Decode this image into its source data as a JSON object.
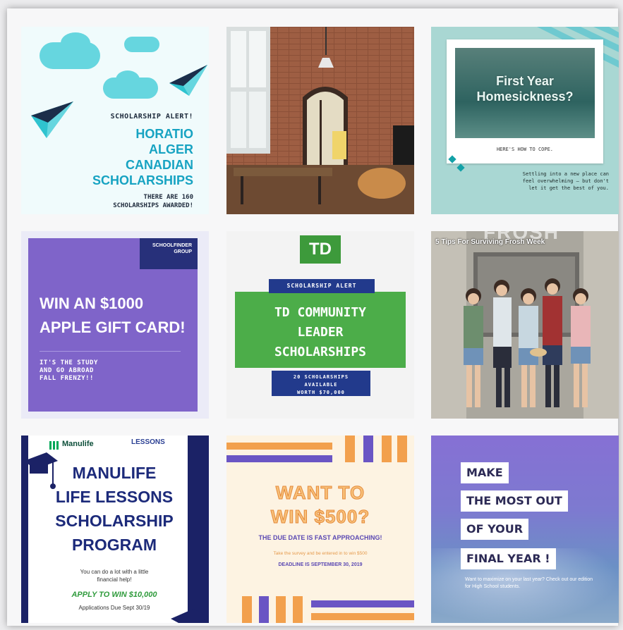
{
  "tile1": {
    "alert": "SCHOLARSHIP ALERT!",
    "title_l1": "HORATIO",
    "title_l2": "ALGER",
    "title_l3": "CANADIAN",
    "title_l4": "SCHOLARSHIPS",
    "foot_l1": "THERE ARE 160",
    "foot_l2": "SCHOLARSHIPS AWARDED!"
  },
  "tile3": {
    "head_l1": "First Year",
    "head_l2": "Homesickness?",
    "cope": "HERE'S HOW TO COPE.",
    "body": "Settling into a new place can feel overwhelming – but don't let it get the best of you."
  },
  "tile4": {
    "logo": "SCHOOLFINDER GROUP",
    "head_l1": "WIN AN $1000",
    "head_l2": "APPLE GIFT CARD!",
    "sub_l1": "IT'S THE STUDY",
    "sub_l2": "AND GO ABROAD",
    "sub_l3": "FALL FRENZY!!"
  },
  "tile5": {
    "logo": "TD",
    "alert": "SCHOLARSHIP ALERT",
    "title_l1": "TD COMMUNITY",
    "title_l2": "LEADER",
    "title_l3": "SCHOLARSHIPS",
    "avail_l1": "20 SCHOLARSHIPS",
    "avail_l2": "AVAILABLE",
    "avail_l3": "WORTH $70,000"
  },
  "tile6": {
    "frosh": "FROSH",
    "caption": "5 Tips For Surviving Frosh Week"
  },
  "tile7": {
    "brand": "Manulife",
    "lessons": "LESSONS",
    "title_l1": "MANULIFE",
    "title_l2": "LIFE LESSONS",
    "title_l3": "SCHOLARSHIP",
    "title_l4": "PROGRAM",
    "small_l1": "You can do a lot with a little",
    "small_l2": "financial help!",
    "apply": "APPLY TO WIN $10,000",
    "due": "Applications Due Sept 30/19"
  },
  "tile8": {
    "want_l1": "WANT TO",
    "want_l2": "WIN $500?",
    "due": "THE DUE DATE IS FAST APPROACHING!",
    "small": "Take the survey and be entered in to win $500",
    "deadline": "DEADLINE IS SEPTEMBER 30, 2019"
  },
  "tile9": {
    "line1": "MAKE",
    "line2": "THE MOST OUT",
    "line3": "OF YOUR",
    "line4": "FINAL YEAR !",
    "small": "Want to maximize on your last year? Check out our edition for High School students."
  },
  "colors": {
    "cloud": "#66d6df",
    "tile4_card": "#7f64c9",
    "td_green": "#4cad49",
    "td_navy": "#223a8c",
    "manulife_navy": "#1b2266",
    "bar_purple": "#6a55c4",
    "bar_orange": "#f2a04d"
  }
}
